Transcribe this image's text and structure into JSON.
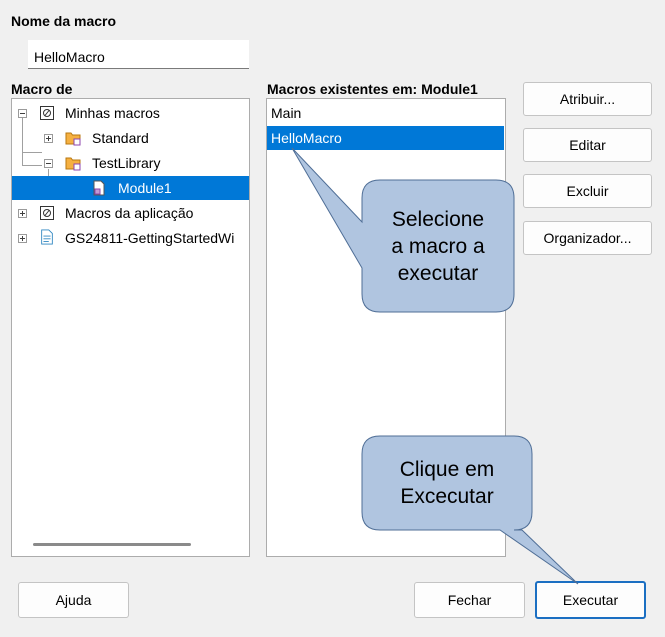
{
  "macro_name": {
    "label": "Nome da macro",
    "value": "HelloMacro"
  },
  "macro_from": {
    "label": "Macro de",
    "tree": [
      {
        "label": "Minhas macros",
        "icon": "macro-container-icon"
      },
      {
        "label": "Standard",
        "icon": "library-folder-icon"
      },
      {
        "label": "TestLibrary",
        "icon": "library-folder-icon"
      },
      {
        "label": "Module1",
        "icon": "module-document-icon"
      },
      {
        "label": "Macros da aplicação",
        "icon": "macro-container-icon"
      },
      {
        "label": "GS24811-GettingStartedWi",
        "icon": "document-icon"
      }
    ]
  },
  "existing_macros": {
    "label": "Macros existentes em: Module1",
    "items": [
      "Main",
      "HelloMacro"
    ],
    "selected": "HelloMacro"
  },
  "side_buttons": {
    "assign": "Atribuir...",
    "edit": "Editar",
    "delete": "Excluir",
    "organizer": "Organizador..."
  },
  "bottom_buttons": {
    "help": "Ajuda",
    "close": "Fechar",
    "run": "Executar"
  },
  "callouts": {
    "select": [
      "Selecione",
      "a macro a",
      "executar"
    ],
    "click": [
      "Clique em",
      "Excecutar"
    ]
  },
  "colors": {
    "selection": "#0078d7",
    "callout_fill": "#b0c5e0",
    "callout_border": "#4f6e96",
    "default_button_border": "#1b6fc2"
  }
}
